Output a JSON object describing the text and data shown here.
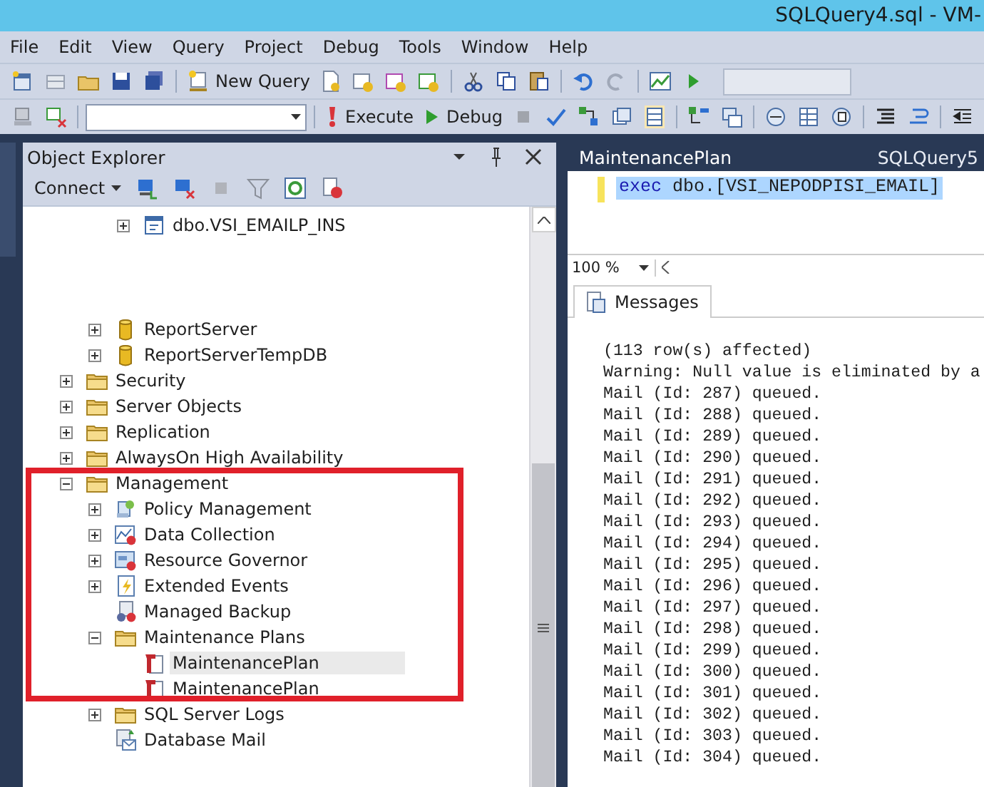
{
  "window": {
    "title": "SQLQuery4.sql - VM-"
  },
  "menu": [
    "File",
    "Edit",
    "View",
    "Query",
    "Project",
    "Debug",
    "Tools",
    "Window",
    "Help"
  ],
  "toolbar": {
    "new_query": "New Query",
    "execute": "Execute",
    "debug": "Debug"
  },
  "object_explorer": {
    "title": "Object Explorer",
    "connect": "Connect",
    "tree": [
      {
        "children": [
          {
            "children": [
              {
                "label": "dbo.VSI_EMAILP_INS",
                "kind": "procedure",
                "expanded": false,
                "selected": false
              }
            ]
          },
          {
            "label": "ReportServer",
            "kind": "database",
            "expanded": false,
            "selected": false
          },
          {
            "label": "ReportServerTempDB",
            "kind": "database",
            "expanded": false,
            "selected": false
          }
        ]
      },
      {
        "label": "Security",
        "kind": "folder",
        "expanded": false,
        "selected": false
      },
      {
        "label": "Server Objects",
        "kind": "folder",
        "expanded": false,
        "selected": false
      },
      {
        "label": "Replication",
        "kind": "folder",
        "expanded": false,
        "selected": false
      },
      {
        "label": "AlwaysOn High Availability",
        "kind": "folder",
        "expanded": false,
        "selected": false
      },
      {
        "label": "Management",
        "kind": "folder",
        "expanded": true,
        "selected": false,
        "children": [
          {
            "label": "Policy Management",
            "kind": "policy",
            "expanded": false,
            "selected": false
          },
          {
            "label": "Data Collection",
            "kind": "chart",
            "expanded": false,
            "selected": false
          },
          {
            "label": "Resource Governor",
            "kind": "governor",
            "expanded": false,
            "selected": false
          },
          {
            "label": "Extended Events",
            "kind": "events",
            "expanded": false,
            "selected": false
          },
          {
            "label": "Managed Backup",
            "kind": "backup",
            "selected": false
          },
          {
            "label": "Maintenance Plans",
            "kind": "folder",
            "expanded": true,
            "selected": false,
            "children": [
              {
                "label": "MaintenancePlan",
                "kind": "plan",
                "selected": true
              },
              {
                "label": "MaintenancePlan",
                "kind": "plan",
                "selected": false
              }
            ]
          },
          {
            "label": "SQL Server Logs",
            "kind": "folder",
            "expanded": false,
            "selected": false
          },
          {
            "label": "Database Mail",
            "kind": "mail",
            "selected": false
          }
        ]
      }
    ]
  },
  "editor": {
    "tabs": [
      {
        "label": "MaintenancePlan",
        "selected": true
      },
      {
        "label": "SQLQuery5",
        "selected": false
      }
    ],
    "line": [
      {
        "kind": "keyword",
        "text": "exec"
      },
      {
        "kind": "plain",
        "text": " dbo.[VSI_NEPODPISI_EMAIL]"
      }
    ],
    "zoom": "100 %"
  },
  "results": {
    "tab": "Messages",
    "lines": [
      "(113 row(s) affected)",
      "Warning: Null value is eliminated by a",
      "Mail (Id: 287) queued.",
      "Mail (Id: 288) queued.",
      "Mail (Id: 289) queued.",
      "Mail (Id: 290) queued.",
      "Mail (Id: 291) queued.",
      "Mail (Id: 292) queued.",
      "Mail (Id: 293) queued.",
      "Mail (Id: 294) queued.",
      "Mail (Id: 295) queued.",
      "Mail (Id: 296) queued.",
      "Mail (Id: 297) queued.",
      "Mail (Id: 298) queued.",
      "Mail (Id: 299) queued.",
      "Mail (Id: 300) queued.",
      "Mail (Id: 301) queued.",
      "Mail (Id: 302) queued.",
      "Mail (Id: 303) queued.",
      "Mail (Id: 304) queued."
    ]
  }
}
